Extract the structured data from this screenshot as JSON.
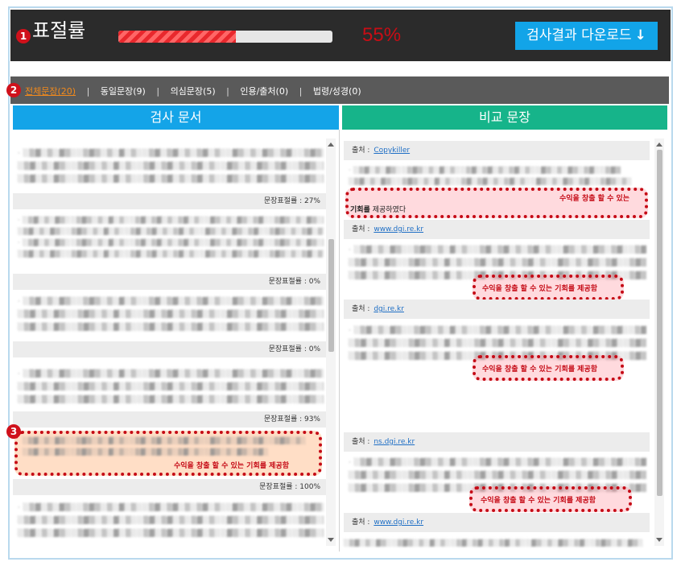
{
  "header": {
    "badge": "1",
    "title": "표절률",
    "progress_fraction": 0.55,
    "percent": "55%",
    "download_label": "검사결과 다운로드",
    "download_icon": "arrow-down-icon"
  },
  "filters": {
    "badge": "2",
    "items": [
      {
        "label": "전체문장(20)"
      },
      {
        "label": "동일문장(9)"
      },
      {
        "label": "의심문장(5)"
      },
      {
        "label": "인용/출처(0)"
      },
      {
        "label": "법령/성경(0)"
      }
    ],
    "separator": "|"
  },
  "left_panel": {
    "title": "검사 문서",
    "rates": [
      "문장표절률 : 27%",
      "문장표절률 : 0%",
      "문장표절률 : 0%",
      "문장표절률 : 93%",
      "문장표절률 : 100%"
    ],
    "badge": "3",
    "highlight": "수익을 창출 할 수 있는 기회를 제공함"
  },
  "right_panel": {
    "title": "비교 문장",
    "source_label": "출처 : ",
    "sources": [
      "Copykiller",
      "www.dgi.re.kr",
      "dgi.re.kr",
      "ns.dgi.re.kr",
      "www.dgi.re.kr"
    ],
    "highlight1_red": "수익을 창출 할 수 있는",
    "highlight1_rest_bold": "기회를",
    "highlight1_rest": " 제공하였다",
    "highlight": "수익을 창출 할 수 있는 기회를 제공함"
  },
  "colors": {
    "topbar": "#2b2b2b",
    "accent_red": "#c80d15",
    "download_button": "#12a4e8",
    "left_header": "#14a4e8",
    "right_header": "#16b48a",
    "filter_active": "#f28a1c"
  }
}
